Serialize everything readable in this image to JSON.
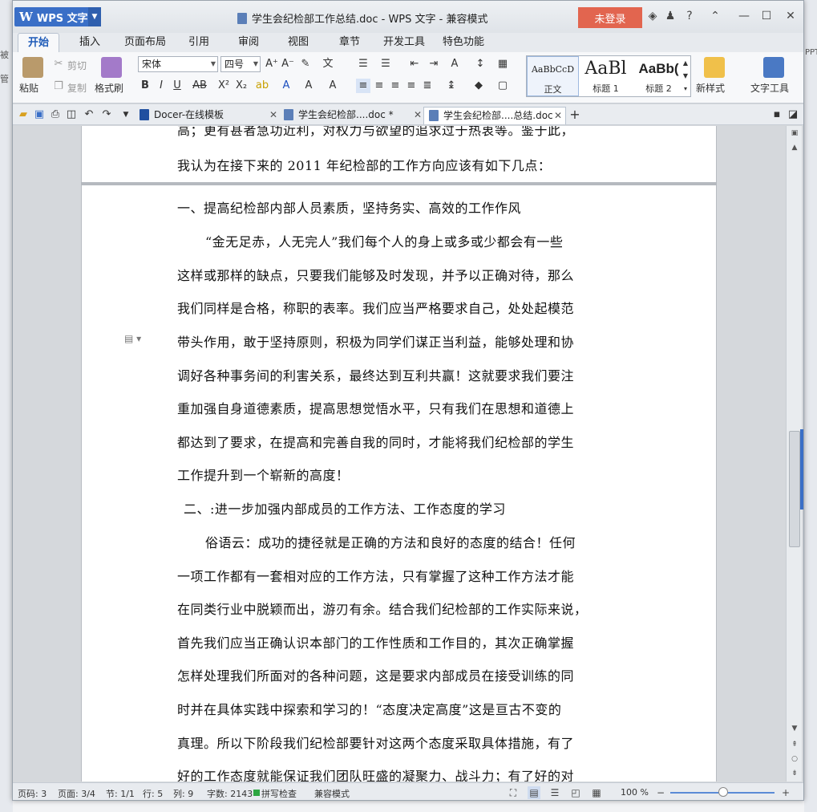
{
  "background": {
    "left_text_1": "被",
    "left_text_2": "管",
    "right_text_1": "PPT"
  },
  "titlebar": {
    "app_button": "WPS 文字",
    "doc_title": "学生会纪检部工作总结.doc - WPS 文字 - 兼容模式",
    "login": "未登录",
    "help": "?"
  },
  "tabs": [
    "开始",
    "插入",
    "页面布局",
    "引用",
    "审阅",
    "视图",
    "章节",
    "开发工具",
    "特色功能"
  ],
  "ribbon": {
    "paste": "粘贴",
    "cut": "剪切",
    "copy": "复制",
    "format_painter": "格式刷",
    "font_name": "宋体",
    "font_size": "四号",
    "styles": [
      {
        "sample": "AaBbCcD",
        "name": "正文"
      },
      {
        "sample": "AaBl",
        "name": "标题 1"
      },
      {
        "sample": "AaBb(",
        "name": "标题 2"
      }
    ],
    "new_style": "新样式",
    "text_tools": "文字工具"
  },
  "doc_tabs": [
    {
      "label": "Docer-在线模板"
    },
    {
      "label": "学生会纪检部....doc *"
    },
    {
      "label": "学生会纪检部....总结.doc"
    }
  ],
  "document": {
    "lines": [
      "高；更有甚者急功近利，对权力与欲望的追求过于热衷等。鉴于此，",
      "我认为在接下来的 2011 年纪检部的工作方向应该有如下几点：",
      "一、提高纪检部内部人员素质，坚持务实、高效的工作作风",
      "“金无足赤，人无完人”我们每个人的身上或多或少都会有一些",
      "这样或那样的缺点，只要我们能够及时发现，并予以正确对待，那么",
      "我们同样是合格，称职的表率。我们应当严格要求自己，处处起模范",
      "带头作用，敢于坚持原则，积极为同学们谋正当利益，能够处理和协",
      "调好各种事务间的利害关系，最终达到互利共赢！这就要求我们要注",
      "重加强自身道德素质，提高思想觉悟水平，只有我们在思想和道德上",
      "都达到了要求，在提高和完善自我的同时，才能将我们纪检部的学生",
      "工作提升到一个崭新的高度！",
      "二、:进一步加强内部成员的工作方法、工作态度的学习",
      "俗语云：成功的捷径就是正确的方法和良好的态度的结合！任何",
      "一项工作都有一套相对应的工作方法，只有掌握了这种工作方法才能",
      "在同类行业中脱颖而出，游刃有余。结合我们纪检部的工作实际来说，",
      "首先我们应当正确认识本部门的工作性质和工作目的，其次正确掌握",
      "怎样处理我们所面对的各种问题，这是要求内部成员在接受训练的同",
      "时并在具体实践中探索和学习的！“态度决定高度”这是亘古不变的",
      "真理。所以下阶段我们纪检部要针对这两个态度采取具体措施，有了",
      "好的工作态度就能保证我们团队旺盛的凝聚力、战斗力；有了好的对"
    ]
  },
  "status": {
    "page_no": "页码: 3",
    "pages": "页面: 3/4",
    "section": "节: 1/1",
    "row": "行: 5",
    "col": "列: 9",
    "words": "字数: 2143",
    "spell": "拼写检查",
    "mode": "兼容模式",
    "zoom": "100 %"
  }
}
